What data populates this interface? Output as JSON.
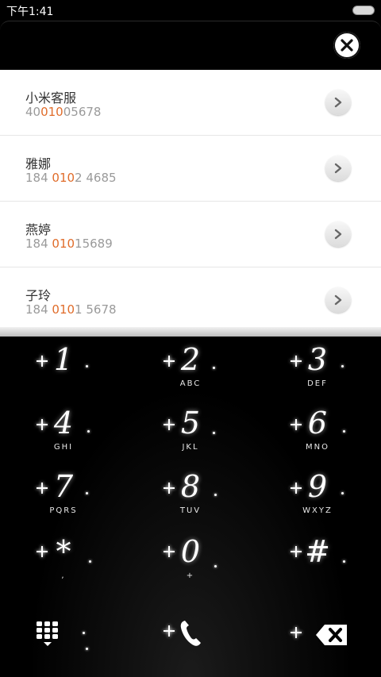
{
  "status": {
    "time": "下午1:41"
  },
  "results": [
    {
      "name": "小米客服",
      "num_pre": "40",
      "num_hl": "010",
      "num_post": "05678"
    },
    {
      "name": "雅娜",
      "num_pre": "184 ",
      "num_hl": "010",
      "num_post": "2 4685"
    },
    {
      "name": "燕婷",
      "num_pre": "184 ",
      "num_hl": "010",
      "num_post": "15689"
    },
    {
      "name": "子玲",
      "num_pre": "184 ",
      "num_hl": "010",
      "num_post": "1 5678"
    }
  ],
  "keys": [
    {
      "digit": "1",
      "letters": ""
    },
    {
      "digit": "2",
      "letters": "ABC"
    },
    {
      "digit": "3",
      "letters": "DEF"
    },
    {
      "digit": "4",
      "letters": "GHI"
    },
    {
      "digit": "5",
      "letters": "JKL"
    },
    {
      "digit": "6",
      "letters": "MNO"
    },
    {
      "digit": "7",
      "letters": "PQRS"
    },
    {
      "digit": "8",
      "letters": "TUV"
    },
    {
      "digit": "9",
      "letters": "WXYZ"
    },
    {
      "digit": "*",
      "letters": ","
    },
    {
      "digit": "0",
      "letters": "+"
    },
    {
      "digit": "#",
      "letters": ""
    }
  ],
  "colors": {
    "highlight": "#e06c2a",
    "background": "#000000",
    "list_bg": "#ffffff"
  },
  "icons": {
    "close": "close-icon",
    "arrow": "chevron-right-icon",
    "dialpad": "dialpad-grid-icon",
    "call": "phone-handset-icon",
    "delete": "backspace-icon"
  }
}
